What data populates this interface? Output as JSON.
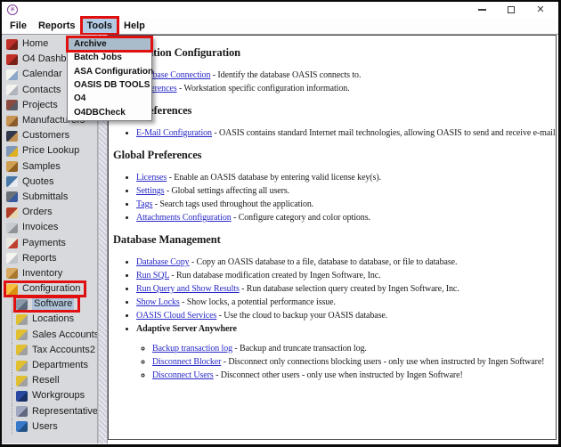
{
  "window": {
    "title": "",
    "logo_icon": "oasis-flower-logo",
    "logo_glyph": "✳",
    "controls": [
      {
        "name": "minimize",
        "icon": "minimize-icon"
      },
      {
        "name": "maximize",
        "icon": "maximize-icon"
      },
      {
        "name": "close",
        "icon": "close-icon",
        "glyph": "✕"
      }
    ]
  },
  "colors": {
    "menu_highlight": "#b3cbe4",
    "dropdown_selection": "#a9bccb",
    "tree_selection": "#aec4da",
    "annotation_red": "#e01010",
    "link_blue": "#2828c8",
    "sidebar_bg": "#d7d9dc"
  },
  "menu_bar": {
    "items": [
      {
        "label": "File",
        "highlighted": false
      },
      {
        "label": "Reports",
        "highlighted": false
      },
      {
        "label": "Tools",
        "highlighted": true,
        "annotated": true
      },
      {
        "label": "Help",
        "highlighted": false
      }
    ]
  },
  "tools_menu": {
    "items": [
      {
        "label": "Archive",
        "highlighted": true,
        "annotated": true
      },
      {
        "label": "Batch Jobs",
        "highlighted": false
      },
      {
        "label": "ASA Configuration",
        "highlighted": false
      },
      {
        "label": "OASIS DB TOOLS",
        "highlighted": false
      },
      {
        "label": "O4",
        "highlighted": false
      },
      {
        "label": "O4DBCheck",
        "highlighted": false
      }
    ]
  },
  "sidebar": {
    "items": [
      {
        "label": "Home",
        "icon": "home-icon",
        "colors": [
          "#c03028",
          "#7a2018"
        ]
      },
      {
        "label": "O4 Dashboard",
        "icon": "dashboard-icon",
        "colors": [
          "#c03028",
          "#7a2018"
        ]
      },
      {
        "label": "Calendar",
        "icon": "calendar-icon",
        "colors": [
          "#f5f5f0",
          "#90a8c8"
        ]
      },
      {
        "label": "Contacts",
        "icon": "contacts-icon",
        "colors": [
          "#f2f2ee",
          "#b0b4bc"
        ]
      },
      {
        "label": "Projects",
        "icon": "projects-icon",
        "colors": [
          "#8a4a40",
          "#5a5a64"
        ]
      },
      {
        "label": "Manufacturers",
        "icon": "manufacturers-icon",
        "colors": [
          "#c89454",
          "#8a5c2c"
        ]
      },
      {
        "label": "Customers",
        "icon": "customers-icon",
        "colors": [
          "#30384a",
          "#c09050"
        ]
      },
      {
        "label": "Price Lookup",
        "icon": "price-lookup-icon",
        "colors": [
          "#8098b8",
          "#e0b020"
        ]
      },
      {
        "label": "Samples",
        "icon": "samples-icon",
        "colors": [
          "#d0a050",
          "#906020"
        ]
      },
      {
        "label": "Quotes",
        "icon": "quotes-icon",
        "colors": [
          "#4878a8",
          "#e8ecf0"
        ]
      },
      {
        "label": "Submittals",
        "icon": "submittals-icon",
        "colors": [
          "#687078",
          "#3858a0"
        ]
      },
      {
        "label": "Orders",
        "icon": "orders-icon",
        "colors": [
          "#b03c28",
          "#e8d8b0"
        ]
      },
      {
        "label": "Invoices",
        "icon": "invoices-icon",
        "colors": [
          "#c8ccd0",
          "#909498"
        ]
      },
      {
        "label": "Payments",
        "icon": "payments-icon",
        "colors": [
          "#e8e8e0",
          "#c04030"
        ]
      },
      {
        "label": "Reports",
        "icon": "reports-icon",
        "colors": [
          "#f4f4f0",
          "#c0c4c8"
        ]
      },
      {
        "label": "Inventory",
        "icon": "inventory-icon",
        "colors": [
          "#d8a860",
          "#a87830"
        ]
      },
      {
        "label": "Configuration",
        "icon": "open-folder-icon",
        "colors": [
          "#f8c040",
          "#d89010"
        ],
        "annotated": true
      },
      {
        "label": "Software",
        "icon": "software-icon",
        "colors": [
          "#8898a8",
          "#5a6a7a"
        ],
        "child": true,
        "annotated": true,
        "selected": true
      },
      {
        "label": "Locations",
        "icon": "locations-icon",
        "colors": [
          "#e0c030",
          "#a0a0a0"
        ],
        "child": true
      },
      {
        "label": "Sales Accounts",
        "icon": "sales-accounts-icon",
        "colors": [
          "#e0c030",
          "#a0a0a0"
        ],
        "child": true
      },
      {
        "label": "Tax Accounts2",
        "icon": "tax-accounts-icon",
        "colors": [
          "#e0c030",
          "#a0a0a0"
        ],
        "child": true
      },
      {
        "label": "Departments",
        "icon": "departments-icon",
        "colors": [
          "#e0c030",
          "#a0a0a0"
        ],
        "child": true
      },
      {
        "label": "Resell",
        "icon": "resell-icon",
        "colors": [
          "#e0c030",
          "#a0a0a0"
        ],
        "child": true
      },
      {
        "label": "Workgroups",
        "icon": "workgroups-icon",
        "colors": [
          "#2848a0",
          "#183068"
        ],
        "child": true
      },
      {
        "label": "Representatives",
        "icon": "representatives-icon",
        "colors": [
          "#a0a8c0",
          "#606880"
        ],
        "child": true
      },
      {
        "label": "Users",
        "icon": "users-icon",
        "colors": [
          "#3878c8",
          "#205088"
        ],
        "child": true
      }
    ]
  },
  "content": {
    "sections": [
      {
        "heading": "Workstation Configuration",
        "items": [
          {
            "link": "Database Connection",
            "desc": "- Identify the database OASIS connects to."
          },
          {
            "link": "Preferences",
            "desc": "- Workstation specific configuration information."
          }
        ]
      },
      {
        "heading": "User Preferences",
        "items": [
          {
            "link": "E-Mail Configuration",
            "desc": "- OASIS contains standard Internet mail technologies, allowing OASIS to send and receive e-mail."
          }
        ]
      },
      {
        "heading": "Global Preferences",
        "items": [
          {
            "link": "Licenses",
            "desc": "- Enable an OASIS database by entering valid license key(s)."
          },
          {
            "link": "Settings",
            "desc": "- Global settings affecting all users."
          },
          {
            "link": "Tags",
            "desc": "- Search tags used throughout the application."
          },
          {
            "link": "Attachments Configuration",
            "desc": "- Configure category and color options."
          }
        ]
      },
      {
        "heading": "Database Management",
        "items": [
          {
            "link": "Database Copy",
            "desc": "- Copy an OASIS database to a file, database to database, or file to database."
          },
          {
            "link": "Run SQL",
            "desc": "- Run database modification created by Ingen Software, Inc."
          },
          {
            "link": "Run Query and Show Results",
            "desc": "- Run database selection query created by Ingen Software, Inc."
          },
          {
            "link": "Show Locks",
            "desc": "- Show locks, a potential performance issue."
          },
          {
            "link": "OASIS Cloud Services",
            "desc": "- Use the cloud to backup your OASIS database."
          },
          {
            "bold_label": "Adaptive Server Anywhere",
            "sub_items": [
              {
                "link": "Backup transaction log",
                "desc": "- Backup and truncate transaction log."
              },
              {
                "link": "Disconnect Blocker",
                "desc": "- Disconnect only connections blocking users - only use when instructed by Ingen Software!"
              },
              {
                "link": "Disconnect Users",
                "desc": "- Disconnect other users - only use when instructed by Ingen Software!"
              }
            ]
          }
        ]
      }
    ]
  }
}
